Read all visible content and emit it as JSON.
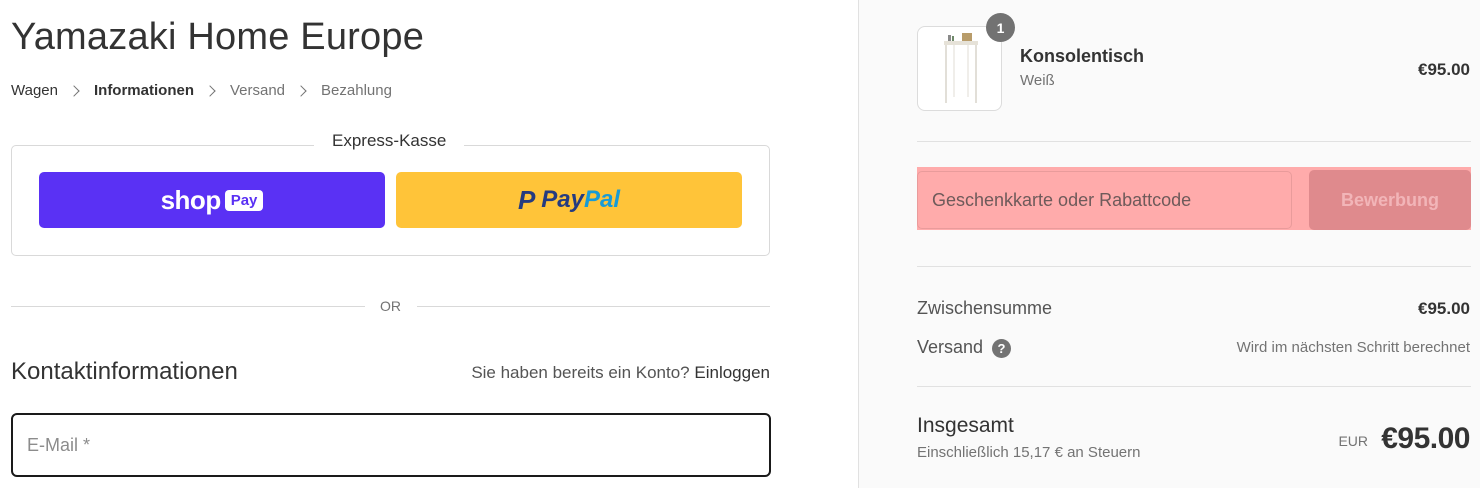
{
  "shop": {
    "title": "Yamazaki Home Europe"
  },
  "breadcrumb": {
    "items": [
      "Wagen",
      "Informationen",
      "Versand",
      "Bezahlung"
    ],
    "current_index": 1,
    "separator_icon": "chevron-right-icon"
  },
  "express": {
    "title": "Express-Kasse",
    "shoppay": {
      "shop": "shop",
      "pay": "Pay",
      "color": "#5a31f4"
    },
    "paypal": {
      "mark": "P",
      "pay": "Pay",
      "pal": "Pal",
      "color": "#ffc439"
    }
  },
  "divider_or": "OR",
  "contact": {
    "title": "Kontaktinformationen",
    "login_prompt": "Sie haben bereits ein Konto?",
    "login_link": "Einloggen",
    "email_placeholder": "E-Mail *",
    "email_value": ""
  },
  "cart": {
    "item": {
      "name": "Konsolentisch",
      "variant": "Weiß",
      "price": "€95.00",
      "quantity": "1"
    }
  },
  "discount": {
    "placeholder": "Geschenkkarte oder Rabattcode",
    "apply_label": "Bewerbung",
    "highlight_color": "#ffabab"
  },
  "summary": {
    "subtotal_label": "Zwischensumme",
    "subtotal_value": "€95.00",
    "shipping_label": "Versand",
    "shipping_note": "Wird im nächsten Schritt berechnet",
    "help_icon": "question-circle-icon"
  },
  "total": {
    "label": "Insgesamt",
    "tax_note": "Einschließlich 15,17 € an Steuern",
    "currency": "EUR",
    "value": "€95.00"
  }
}
